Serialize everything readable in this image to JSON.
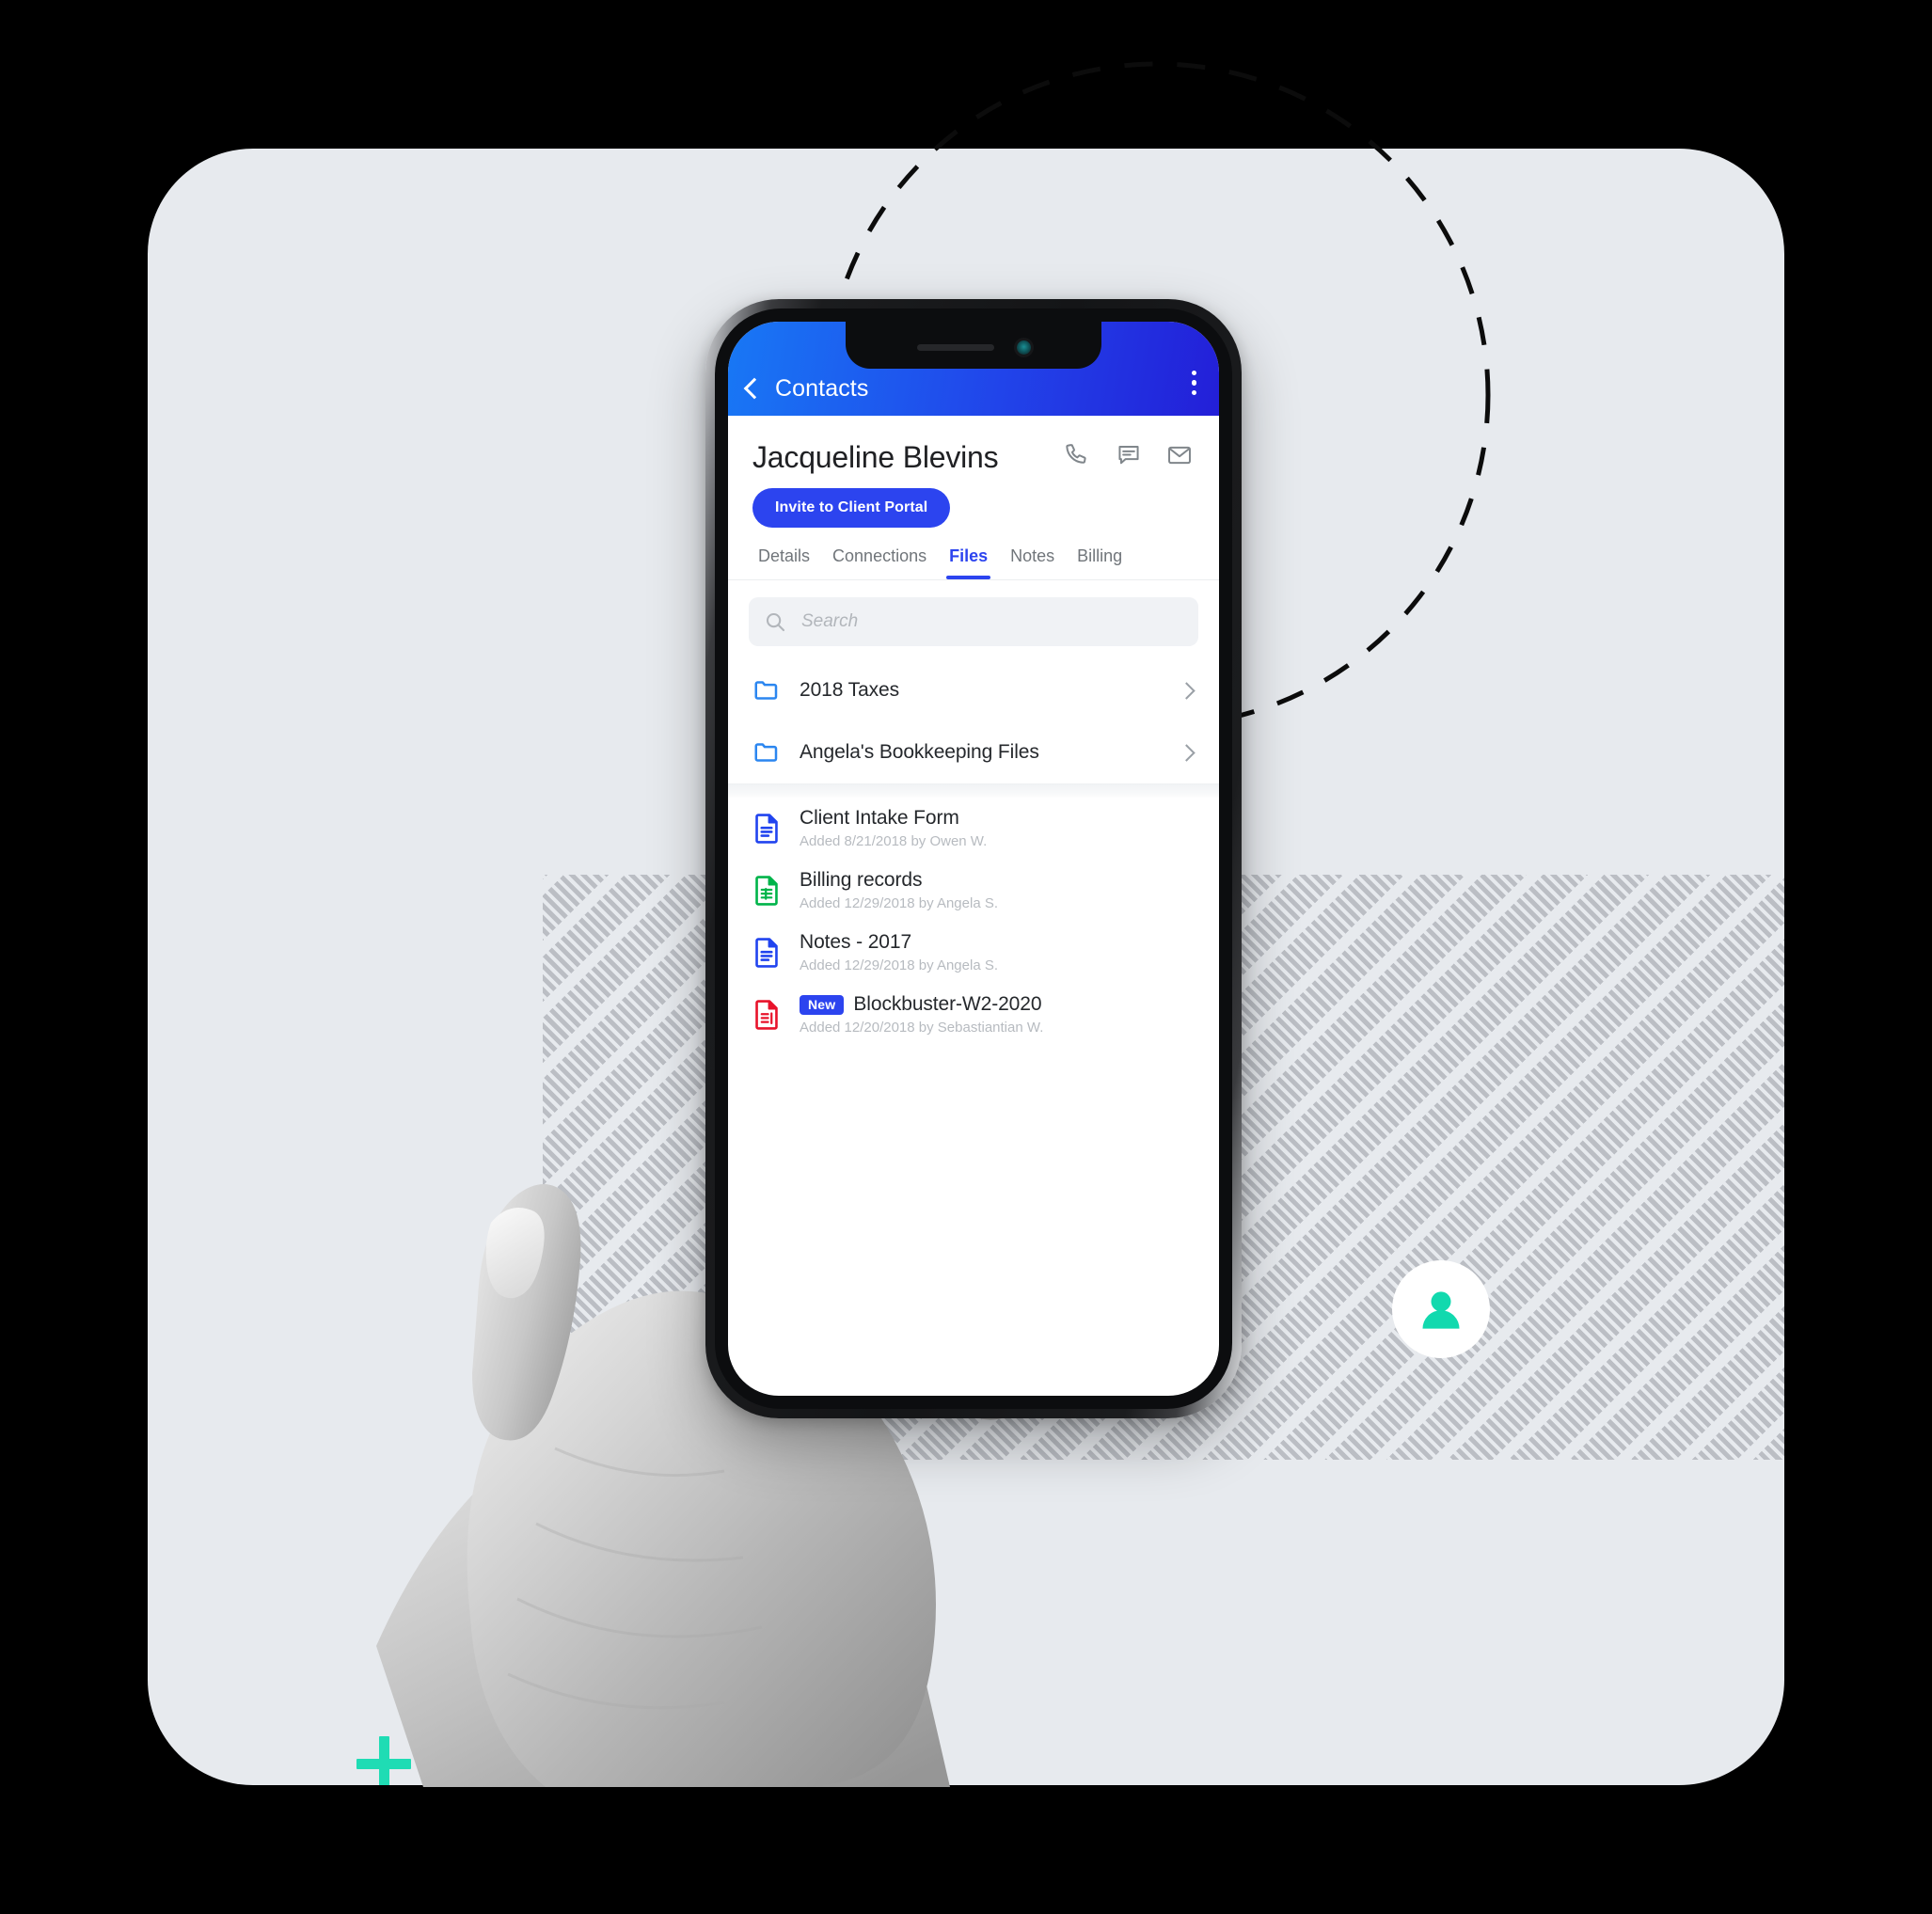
{
  "theme": {
    "card_bg": "#e7eaee",
    "accent_blue": "#2c44ef",
    "appbar_gradient_start": "#1878f5",
    "appbar_gradient_end": "#231fd8",
    "accent_teal": "#1fdcb4",
    "hatch_gray": "#b0b4ba",
    "folder_icon_color": "#2b86f0",
    "doc_icon_color": "#2144ef",
    "sheet_icon_color": "#00b44a",
    "pdf_icon_color": "#e8132b"
  },
  "phone": {
    "appbar": {
      "back_label": "Contacts",
      "back_icon": "chevron-left-icon",
      "overflow_icon": "kebab-menu-icon"
    },
    "contact": {
      "name": "Jacqueline Blevins",
      "actions": [
        {
          "name": "call",
          "icon": "phone-icon"
        },
        {
          "name": "message",
          "icon": "chat-bubble-icon"
        },
        {
          "name": "email",
          "icon": "mail-icon"
        }
      ],
      "invite_button": "Invite to Client Portal"
    },
    "tabs": [
      {
        "label": "Details",
        "active": false
      },
      {
        "label": "Connections",
        "active": false
      },
      {
        "label": "Files",
        "active": true
      },
      {
        "label": "Notes",
        "active": false
      },
      {
        "label": "Billing",
        "active": false
      }
    ],
    "search": {
      "placeholder": "Search",
      "value": "",
      "icon": "search-icon"
    },
    "folders": [
      {
        "name": "2018 Taxes",
        "icon": "folder-icon"
      },
      {
        "name": "Angela's Bookkeeping Files",
        "icon": "folder-icon"
      }
    ],
    "files": [
      {
        "title": "Client Intake Form",
        "subtitle": "Added 8/21/2018 by Owen W.",
        "icon": "doc-file-icon",
        "badge": ""
      },
      {
        "title": "Billing records",
        "subtitle": "Added 12/29/2018 by Angela S.",
        "icon": "sheet-file-icon",
        "badge": ""
      },
      {
        "title": "Notes - 2017",
        "subtitle": "Added 12/29/2018 by Angela S.",
        "icon": "doc-file-icon",
        "badge": ""
      },
      {
        "title": "Blockbuster-W2-2020",
        "subtitle": "Added 12/20/2018 by Sebastiantian W.",
        "icon": "pdf-file-icon",
        "badge": "New"
      }
    ]
  },
  "decor": {
    "avatar_icon": "person-avatar-icon",
    "plus_marks": 4,
    "arc_icon": "dashed-circle-arc",
    "hatch_pattern": "diagonal-hatch-band",
    "hand_image": "hand-holding-phone-photo"
  }
}
